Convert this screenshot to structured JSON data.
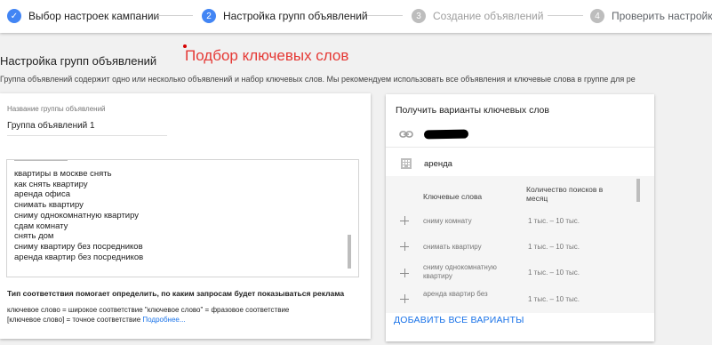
{
  "stepper": {
    "steps": [
      {
        "number": "✓",
        "label": "Выбор настроек кампании",
        "state": "done"
      },
      {
        "number": "2",
        "label": "Настройка групп объявлений",
        "state": "active"
      },
      {
        "number": "3",
        "label": "Создание объявлений",
        "state": "future"
      },
      {
        "number": "4",
        "label": "Проверить настройки",
        "state": "future"
      }
    ]
  },
  "header": {
    "title": "Настройка групп объявлений",
    "annotation": "Подбор ключевых слов",
    "intro": "Группа объявлений содержит одно или несколько объявлений и набор ключевых слов. Мы рекомендуем использовать все объявления и ключевые слова в группе для ре"
  },
  "ad_group": {
    "name_label": "Название группы объявлений",
    "name_value": "Группа объявлений 1",
    "keywords": [
      "квартиры в москве снять",
      "как снять квартиру",
      "аренда офиса",
      "снимать квартиру",
      "сниму однокомнатную квартиру",
      "сдам комнату",
      "снять дом",
      "сниму квартиру без посредников",
      "аренда квартир без посредников"
    ],
    "match_title": "Тип соответствия помогает определить, по каким запросам будет показываться реклама",
    "match_line1": "ключевое слово = широкое соответствие  \"ключевое слово\" = фразовое соответствие",
    "match_line2": "[ключевое слово] = точное соответствие",
    "more_link": "Подробнее..."
  },
  "suggestions": {
    "title": "Получить варианты ключевых слов",
    "url_icon": "link-icon",
    "category_icon": "building-icon",
    "category_value": "аренда",
    "col_keywords": "Ключевые слова",
    "col_volume": "Количество поисков в месяц",
    "rows": [
      {
        "keyword": "сниму комнату",
        "volume": "1 тыс. – 10 тыс."
      },
      {
        "keyword": "снимать квартиру",
        "volume": "1 тыс. – 10 тыс."
      },
      {
        "keyword": "сниму однокомнатную квартиру",
        "volume": "1 тыс. – 10 тыс."
      },
      {
        "keyword": "аренда квартир без",
        "volume": "1 тыс. – 10 тыс."
      }
    ],
    "add_all": "ДОБАВИТЬ ВСЕ ВАРИАНТЫ"
  },
  "colors": {
    "accent": "#4285f4",
    "annotation_red": "#e53935",
    "link": "#1a73e8"
  }
}
